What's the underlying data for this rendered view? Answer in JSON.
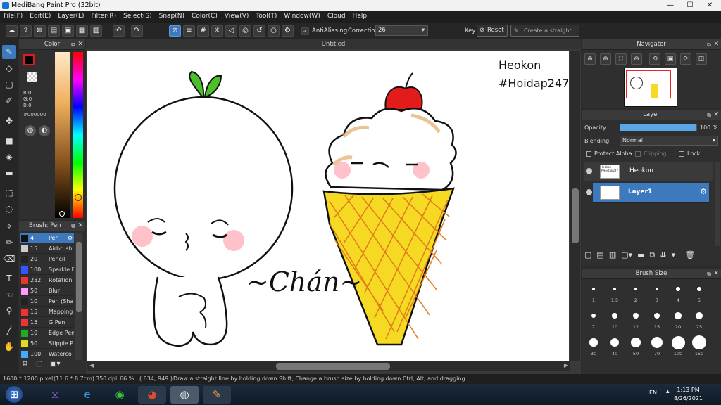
{
  "window": {
    "title": "MediBang Paint Pro (32bit)",
    "min": "—",
    "max": "☐",
    "close": "✕"
  },
  "menu": [
    "File(F)",
    "Edit(E)",
    "Layer(L)",
    "Filter(R)",
    "Select(S)",
    "Snap(N)",
    "Color(C)",
    "View(V)",
    "Tool(T)",
    "Window(W)",
    "Cloud",
    "Help"
  ],
  "toolbar": {
    "antialiasing_label": "AntiAliasing",
    "correction_label": "Correction",
    "correction_value": "26",
    "key_label": "Key",
    "reset_label": "Reset",
    "straight_line_label": "Create a straight line"
  },
  "color_panel": {
    "title": "Color",
    "fg_color": "#000000",
    "rgb": [
      "R:0",
      "G:0",
      "B:0"
    ],
    "hex": "#000000"
  },
  "brush_panel": {
    "title": "Brush: Pen",
    "brushes": [
      {
        "size": "4",
        "name": "Pen",
        "color": "#111111",
        "selected": true
      },
      {
        "size": "15",
        "name": "Airbrush",
        "color": "#cccccc"
      },
      {
        "size": "20",
        "name": "Pencil",
        "color": "#222222"
      },
      {
        "size": "100",
        "name": "Sparkle B",
        "color": "#3355ff"
      },
      {
        "size": "282",
        "name": "Rotation",
        "color": "#ee3333"
      },
      {
        "size": "50",
        "name": "Blur",
        "color": "#ff99ff"
      },
      {
        "size": "10",
        "name": "Pen (Sha",
        "color": "#222222"
      },
      {
        "size": "15",
        "name": "Mapping",
        "color": "#ee3333"
      },
      {
        "size": "15",
        "name": "G Pen",
        "color": "#ee3333"
      },
      {
        "size": "10",
        "name": "Edge Pen",
        "color": "#22aa22"
      },
      {
        "size": "50",
        "name": "Stipple P",
        "color": "#dddd22"
      },
      {
        "size": "100",
        "name": "Waterco",
        "color": "#44aaff"
      }
    ]
  },
  "canvas": {
    "tab_title": "Untitled",
    "text_line1": "Heokon",
    "text_line2": "#Hoidap247",
    "handwriting": "~Chán~"
  },
  "status": {
    "size": "1600 * 1200 pixel",
    "physical": "(11.6 * 8.7cm)",
    "dpi": "350 dpi",
    "zoom": "66 %",
    "coords": "( 634, 949 )",
    "hint": "Draw a straight line by holding down Shift, Change a brush size by holding down Ctrl, Alt, and dragging"
  },
  "navigator": {
    "title": "Navigator"
  },
  "layer_panel": {
    "title": "Layer",
    "opacity_label": "Opacity",
    "opacity_value": "100 %",
    "opacity_fraction": 1.0,
    "blending_label": "Blending",
    "blending_value": "Normal",
    "protect_alpha": "Protect Alpha",
    "clipping": "Clipping",
    "lock": "Lock",
    "layers": [
      {
        "name": "Heokon",
        "selected": false
      },
      {
        "name": "Layer1",
        "selected": true
      }
    ]
  },
  "brush_size": {
    "title": "Brush Size",
    "sizes": [
      "1",
      "1.5",
      "2",
      "3",
      "4",
      "5",
      "7",
      "10",
      "12",
      "15",
      "20",
      "25",
      "30",
      "40",
      "50",
      "70",
      "100",
      "150"
    ]
  },
  "taskbar": {
    "lang": "EN",
    "time": "1:13 PM",
    "date": "8/26/2021"
  }
}
